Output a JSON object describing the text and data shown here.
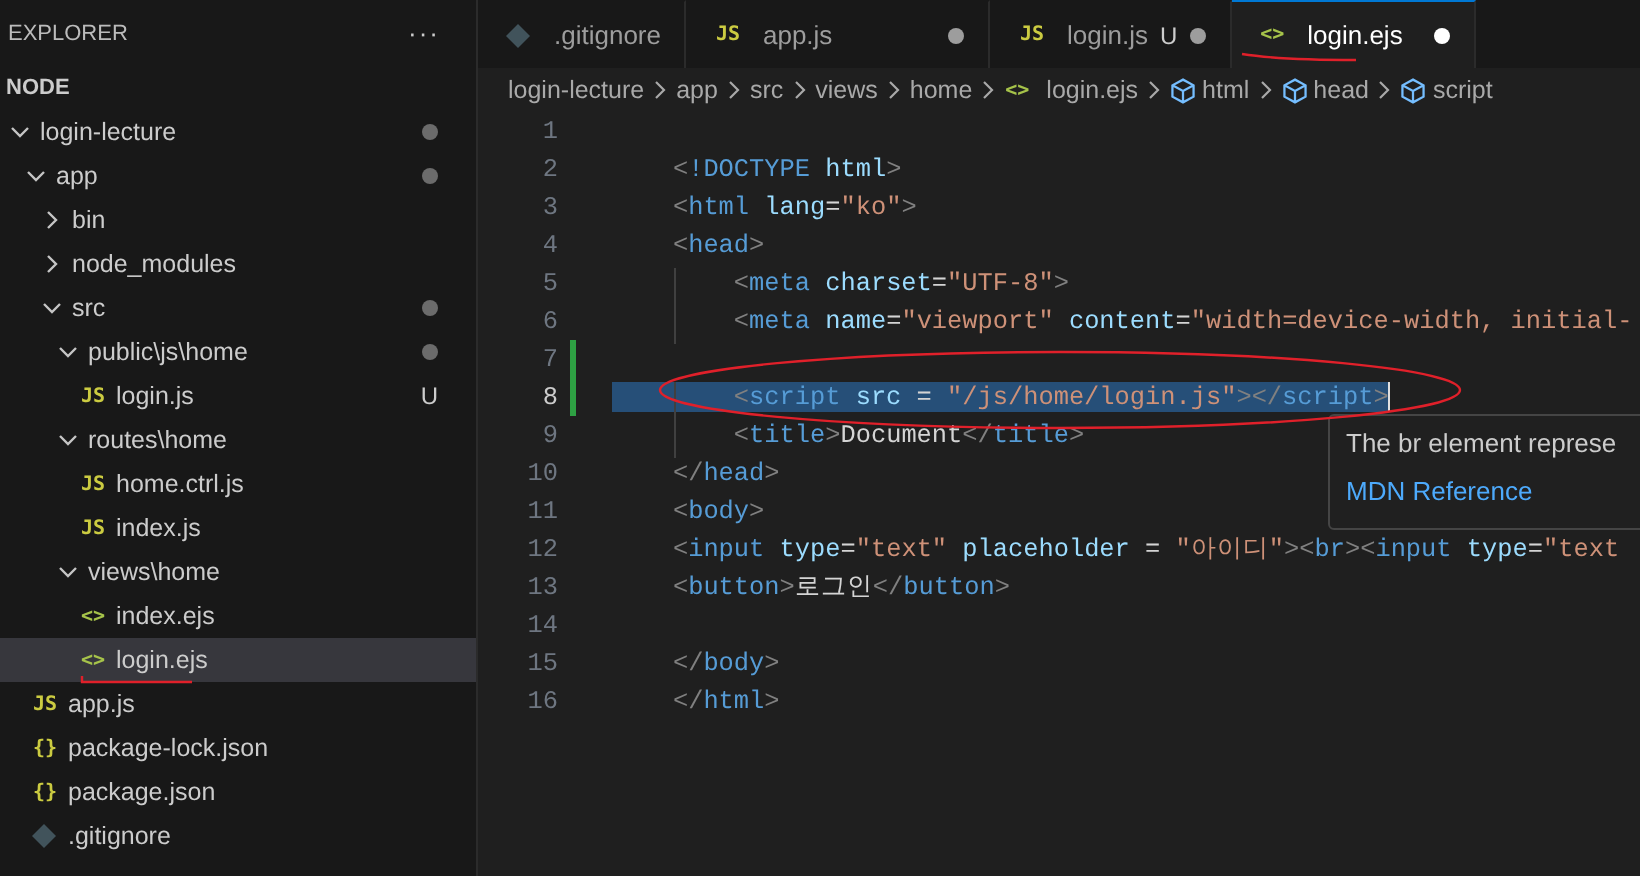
{
  "sidebar": {
    "title": "EXPLORER",
    "more": "···",
    "section": "NODE",
    "tree": [
      {
        "name": "login-lecture",
        "kind": "folder",
        "expanded": true,
        "modified": true,
        "selected": false,
        "children": [
          {
            "name": "app",
            "kind": "folder",
            "expanded": true,
            "modified": true,
            "selected": false,
            "children": [
              {
                "name": "bin",
                "kind": "folder",
                "expanded": false,
                "modified": false,
                "selected": false
              },
              {
                "name": "node_modules",
                "kind": "folder",
                "expanded": false,
                "modified": false,
                "selected": false
              },
              {
                "name": "src",
                "kind": "folder",
                "expanded": true,
                "modified": true,
                "selected": false,
                "children": [
                  {
                    "name": "public\\js\\home",
                    "kind": "folder",
                    "expanded": true,
                    "modified": true,
                    "selected": false,
                    "children": [
                      {
                        "name": "login.js",
                        "kind": "js",
                        "icon": "JS",
                        "modified": false,
                        "selected": false,
                        "badge": "U"
                      }
                    ]
                  },
                  {
                    "name": "routes\\home",
                    "kind": "folder",
                    "expanded": true,
                    "modified": false,
                    "selected": false,
                    "children": [
                      {
                        "name": "home.ctrl.js",
                        "kind": "js",
                        "icon": "JS",
                        "modified": false,
                        "selected": false
                      },
                      {
                        "name": "index.js",
                        "kind": "js",
                        "icon": "JS",
                        "modified": false,
                        "selected": false
                      }
                    ]
                  },
                  {
                    "name": "views\\home",
                    "kind": "folder",
                    "expanded": true,
                    "modified": false,
                    "selected": false,
                    "children": [
                      {
                        "name": "index.ejs",
                        "kind": "ejs",
                        "icon": "<>",
                        "modified": false,
                        "selected": false
                      },
                      {
                        "name": "login.ejs",
                        "kind": "ejs",
                        "icon": "<>",
                        "modified": false,
                        "selected": true
                      }
                    ]
                  }
                ]
              }
            ]
          },
          {
            "name": "app.js",
            "kind": "js",
            "icon": "JS",
            "modified": false,
            "selected": false
          },
          {
            "name": "package-lock.json",
            "kind": "json",
            "icon": "{}",
            "modified": false,
            "selected": false
          },
          {
            "name": "package.json",
            "kind": "json",
            "icon": "{}",
            "modified": false,
            "selected": false
          },
          {
            "name": ".gitignore",
            "kind": "git",
            "modified": false,
            "selected": false
          }
        ]
      }
    ]
  },
  "tabs": [
    {
      "label": ".gitignore",
      "kind": "git",
      "selected": false,
      "dirty": false
    },
    {
      "label": "app.js",
      "kind": "js",
      "icon": "JS",
      "selected": false,
      "dirty": true
    },
    {
      "label": "login.js",
      "kind": "js",
      "icon": "JS",
      "selected": false,
      "dirty": true,
      "badge": "U"
    },
    {
      "label": "login.ejs",
      "kind": "ejs",
      "icon": "<>",
      "selected": true,
      "dirty": true
    }
  ],
  "breadcrumb": [
    {
      "label": "login-lecture",
      "kind": "folder"
    },
    {
      "label": "app",
      "kind": "folder"
    },
    {
      "label": "src",
      "kind": "folder"
    },
    {
      "label": "views",
      "kind": "folder"
    },
    {
      "label": "home",
      "kind": "folder"
    },
    {
      "label": "login.ejs",
      "kind": "ejs",
      "icon": "<>"
    },
    {
      "label": "html",
      "kind": "symbol"
    },
    {
      "label": "head",
      "kind": "symbol"
    },
    {
      "label": "script",
      "kind": "symbol"
    }
  ],
  "lines": [
    {
      "number": "1",
      "selected": false,
      "modified": false
    },
    {
      "number": "2",
      "selected": false,
      "modified": false,
      "tokens": [
        {
          "kind": "punct",
          "text": "    <"
        },
        {
          "kind": "tag",
          "text": "!DOCTYPE"
        },
        {
          "kind": "attr",
          "text": " html"
        },
        {
          "kind": "punct",
          "text": ">"
        }
      ]
    },
    {
      "number": "3",
      "selected": false,
      "modified": false,
      "tokens": [
        {
          "kind": "punct",
          "text": "    <"
        },
        {
          "kind": "tag",
          "text": "html"
        },
        {
          "kind": "attr",
          "text": " lang"
        },
        {
          "kind": "op",
          "text": "="
        },
        {
          "kind": "string",
          "text": "\"ko\""
        },
        {
          "kind": "punct",
          "text": ">"
        }
      ]
    },
    {
      "number": "4",
      "selected": false,
      "modified": false,
      "tokens": [
        {
          "kind": "punct",
          "text": "    <"
        },
        {
          "kind": "tag",
          "text": "head"
        },
        {
          "kind": "punct",
          "text": ">"
        }
      ]
    },
    {
      "number": "5",
      "selected": false,
      "modified": false,
      "tokens": [
        {
          "kind": "punct",
          "text": "        <"
        },
        {
          "kind": "tag",
          "text": "meta"
        },
        {
          "kind": "attr",
          "text": " charset"
        },
        {
          "kind": "op",
          "text": "="
        },
        {
          "kind": "string",
          "text": "\"UTF-8\""
        },
        {
          "kind": "punct",
          "text": ">"
        }
      ]
    },
    {
      "number": "6",
      "selected": false,
      "modified": false,
      "tokens": [
        {
          "kind": "punct",
          "text": "        <"
        },
        {
          "kind": "tag",
          "text": "meta"
        },
        {
          "kind": "attr",
          "text": " name"
        },
        {
          "kind": "op",
          "text": "="
        },
        {
          "kind": "string",
          "text": "\"viewport\""
        },
        {
          "kind": "attr",
          "text": " content"
        },
        {
          "kind": "op",
          "text": "="
        },
        {
          "kind": "string",
          "text": "\"width=device-width, initial-"
        }
      ]
    },
    {
      "number": "7",
      "selected": false,
      "modified": true
    },
    {
      "number": "8",
      "selected": true,
      "modified": true,
      "tokens": [
        {
          "kind": "punct",
          "text": "        <"
        },
        {
          "kind": "tag",
          "text": "script"
        },
        {
          "kind": "attr",
          "text": " src"
        },
        {
          "kind": "op",
          "text": " = "
        },
        {
          "kind": "string",
          "text": "\"/js/home/login.js\""
        },
        {
          "kind": "punct",
          "text": "></"
        },
        {
          "kind": "tag",
          "text": "script"
        },
        {
          "kind": "punct",
          "text": ">"
        }
      ]
    },
    {
      "number": "9",
      "selected": false,
      "modified": false,
      "tokens": [
        {
          "kind": "punct",
          "text": "        <"
        },
        {
          "kind": "tag",
          "text": "title"
        },
        {
          "kind": "punct",
          "text": ">"
        },
        {
          "kind": "plain",
          "text": "Document"
        },
        {
          "kind": "punct",
          "text": "</"
        },
        {
          "kind": "tag",
          "text": "title"
        },
        {
          "kind": "punct",
          "text": ">"
        }
      ]
    },
    {
      "number": "10",
      "selected": false,
      "modified": false,
      "tokens": [
        {
          "kind": "punct",
          "text": "    </"
        },
        {
          "kind": "tag",
          "text": "head"
        },
        {
          "kind": "punct",
          "text": ">"
        }
      ]
    },
    {
      "number": "11",
      "selected": false,
      "modified": false,
      "tokens": [
        {
          "kind": "punct",
          "text": "    <"
        },
        {
          "kind": "tag",
          "text": "body"
        },
        {
          "kind": "punct",
          "text": ">"
        }
      ]
    },
    {
      "number": "12",
      "selected": false,
      "modified": false,
      "tokens": [
        {
          "kind": "punct",
          "text": "    <"
        },
        {
          "kind": "tag",
          "text": "input"
        },
        {
          "kind": "attr",
          "text": " type"
        },
        {
          "kind": "op",
          "text": "="
        },
        {
          "kind": "string",
          "text": "\"text\""
        },
        {
          "kind": "attr",
          "text": " placeholder"
        },
        {
          "kind": "op",
          "text": " = "
        },
        {
          "kind": "string",
          "text": "\"아이디\""
        },
        {
          "kind": "punct",
          "text": "><"
        },
        {
          "kind": "tag",
          "text": "br"
        },
        {
          "kind": "punct",
          "text": "><"
        },
        {
          "kind": "tag",
          "text": "input"
        },
        {
          "kind": "attr",
          "text": " type"
        },
        {
          "kind": "op",
          "text": "="
        },
        {
          "kind": "string",
          "text": "\"text"
        }
      ]
    },
    {
      "number": "13",
      "selected": false,
      "modified": false,
      "tokens": [
        {
          "kind": "punct",
          "text": "    <"
        },
        {
          "kind": "tag",
          "text": "button"
        },
        {
          "kind": "punct",
          "text": ">"
        },
        {
          "kind": "plain",
          "text": "로그인"
        },
        {
          "kind": "punct",
          "text": "</"
        },
        {
          "kind": "tag",
          "text": "button"
        },
        {
          "kind": "punct",
          "text": ">"
        }
      ]
    },
    {
      "number": "14",
      "selected": false,
      "modified": false
    },
    {
      "number": "15",
      "selected": false,
      "modified": false,
      "tokens": [
        {
          "kind": "punct",
          "text": "    </"
        },
        {
          "kind": "tag",
          "text": "body"
        },
        {
          "kind": "punct",
          "text": ">"
        }
      ]
    },
    {
      "number": "16",
      "selected": false,
      "modified": false,
      "tokens": [
        {
          "kind": "punct",
          "text": "    </"
        },
        {
          "kind": "tag",
          "text": "html"
        },
        {
          "kind": "punct",
          "text": ">"
        }
      ]
    }
  ],
  "hover": {
    "text": "The br element represe",
    "link": "MDN Reference"
  }
}
